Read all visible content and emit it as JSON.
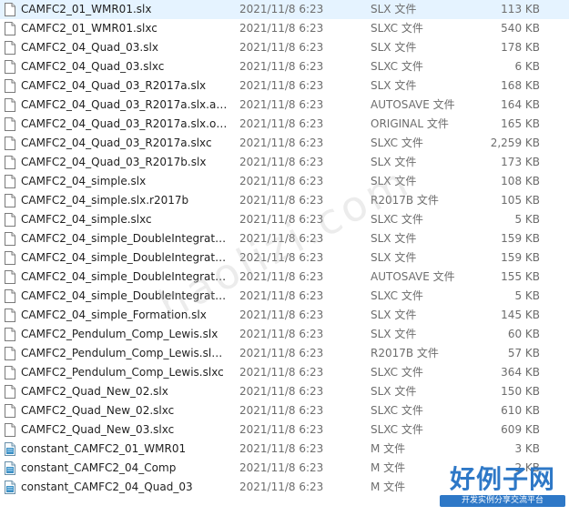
{
  "files": [
    {
      "name": "CAMFC2_01_WMR01.slx",
      "date": "2021/11/8 6:23",
      "type": "SLX 文件",
      "size": "113 KB",
      "icon": "document-icon",
      "selected": true
    },
    {
      "name": "CAMFC2_01_WMR01.slxc",
      "date": "2021/11/8 6:23",
      "type": "SLXC 文件",
      "size": "540 KB",
      "icon": "document-icon"
    },
    {
      "name": "CAMFC2_04_Quad_03.slx",
      "date": "2021/11/8 6:23",
      "type": "SLX 文件",
      "size": "178 KB",
      "icon": "document-icon"
    },
    {
      "name": "CAMFC2_04_Quad_03.slxc",
      "date": "2021/11/8 6:23",
      "type": "SLXC 文件",
      "size": "6 KB",
      "icon": "document-icon"
    },
    {
      "name": "CAMFC2_04_Quad_03_R2017a.slx",
      "date": "2021/11/8 6:23",
      "type": "SLX 文件",
      "size": "168 KB",
      "icon": "document-icon"
    },
    {
      "name": "CAMFC2_04_Quad_03_R2017a.slx.aut...",
      "date": "2021/11/8 6:23",
      "type": "AUTOSAVE 文件",
      "size": "164 KB",
      "icon": "document-icon"
    },
    {
      "name": "CAMFC2_04_Quad_03_R2017a.slx.orig...",
      "date": "2021/11/8 6:23",
      "type": "ORIGINAL 文件",
      "size": "165 KB",
      "icon": "document-icon"
    },
    {
      "name": "CAMFC2_04_Quad_03_R2017a.slxc",
      "date": "2021/11/8 6:23",
      "type": "SLXC 文件",
      "size": "2,259 KB",
      "icon": "document-icon"
    },
    {
      "name": "CAMFC2_04_Quad_03_R2017b.slx",
      "date": "2021/11/8 6:23",
      "type": "SLX 文件",
      "size": "173 KB",
      "icon": "document-icon"
    },
    {
      "name": "CAMFC2_04_simple.slx",
      "date": "2021/11/8 6:23",
      "type": "SLX 文件",
      "size": "108 KB",
      "icon": "document-icon"
    },
    {
      "name": "CAMFC2_04_simple.slx.r2017b",
      "date": "2021/11/8 6:23",
      "type": "R2017B 文件",
      "size": "105 KB",
      "icon": "document-icon"
    },
    {
      "name": "CAMFC2_04_simple.slxc",
      "date": "2021/11/8 6:23",
      "type": "SLXC 文件",
      "size": "5 KB",
      "icon": "document-icon"
    },
    {
      "name": "CAMFC2_04_simple_DoubleIntegrator...",
      "date": "2021/11/8 6:23",
      "type": "SLX 文件",
      "size": "159 KB",
      "icon": "document-icon"
    },
    {
      "name": "CAMFC2_04_simple_DoubleIntegrator...",
      "date": "2021/11/8 6:23",
      "type": "SLX 文件",
      "size": "159 KB",
      "icon": "document-icon"
    },
    {
      "name": "CAMFC2_04_simple_DoubleIntegrator...",
      "date": "2021/11/8 6:23",
      "type": "AUTOSAVE 文件",
      "size": "155 KB",
      "icon": "document-icon"
    },
    {
      "name": "CAMFC2_04_simple_DoubleIntegrator...",
      "date": "2021/11/8 6:23",
      "type": "SLXC 文件",
      "size": "5 KB",
      "icon": "document-icon"
    },
    {
      "name": "CAMFC2_04_simple_Formation.slx",
      "date": "2021/11/8 6:23",
      "type": "SLX 文件",
      "size": "145 KB",
      "icon": "document-icon"
    },
    {
      "name": "CAMFC2_Pendulum_Comp_Lewis.slx",
      "date": "2021/11/8 6:23",
      "type": "SLX 文件",
      "size": "60 KB",
      "icon": "document-icon"
    },
    {
      "name": "CAMFC2_Pendulum_Comp_Lewis.slx.r...",
      "date": "2021/11/8 6:23",
      "type": "R2017B 文件",
      "size": "57 KB",
      "icon": "document-icon"
    },
    {
      "name": "CAMFC2_Pendulum_Comp_Lewis.slxc",
      "date": "2021/11/8 6:23",
      "type": "SLXC 文件",
      "size": "364 KB",
      "icon": "document-icon"
    },
    {
      "name": "CAMFC2_Quad_New_02.slx",
      "date": "2021/11/8 6:23",
      "type": "SLX 文件",
      "size": "150 KB",
      "icon": "document-icon"
    },
    {
      "name": "CAMFC2_Quad_New_02.slxc",
      "date": "2021/11/8 6:23",
      "type": "SLXC 文件",
      "size": "610 KB",
      "icon": "document-icon"
    },
    {
      "name": "CAMFC2_Quad_New_03.slxc",
      "date": "2021/11/8 6:23",
      "type": "SLXC 文件",
      "size": "609 KB",
      "icon": "document-icon"
    },
    {
      "name": "constant_CAMFC2_01_WMR01",
      "date": "2021/11/8 6:23",
      "type": "M 文件",
      "size": "3 KB",
      "icon": "matlab-m-file-icon"
    },
    {
      "name": "constant_CAMFC2_04_Comp",
      "date": "2021/11/8 6:23",
      "type": "M 文件",
      "size": "2 KB",
      "icon": "matlab-m-file-icon"
    },
    {
      "name": "constant_CAMFC2_04_Quad_03",
      "date": "2021/11/8 6:23",
      "type": "M 文件",
      "size": "",
      "icon": "matlab-m-file-icon"
    }
  ],
  "watermark": "haolizi.com",
  "logo": {
    "main": "好例子网",
    "sub": "开发实例分享交流平台"
  },
  "colors": {
    "selected_row": "#e5f3ff",
    "logo_blue": "#2e78c7"
  }
}
